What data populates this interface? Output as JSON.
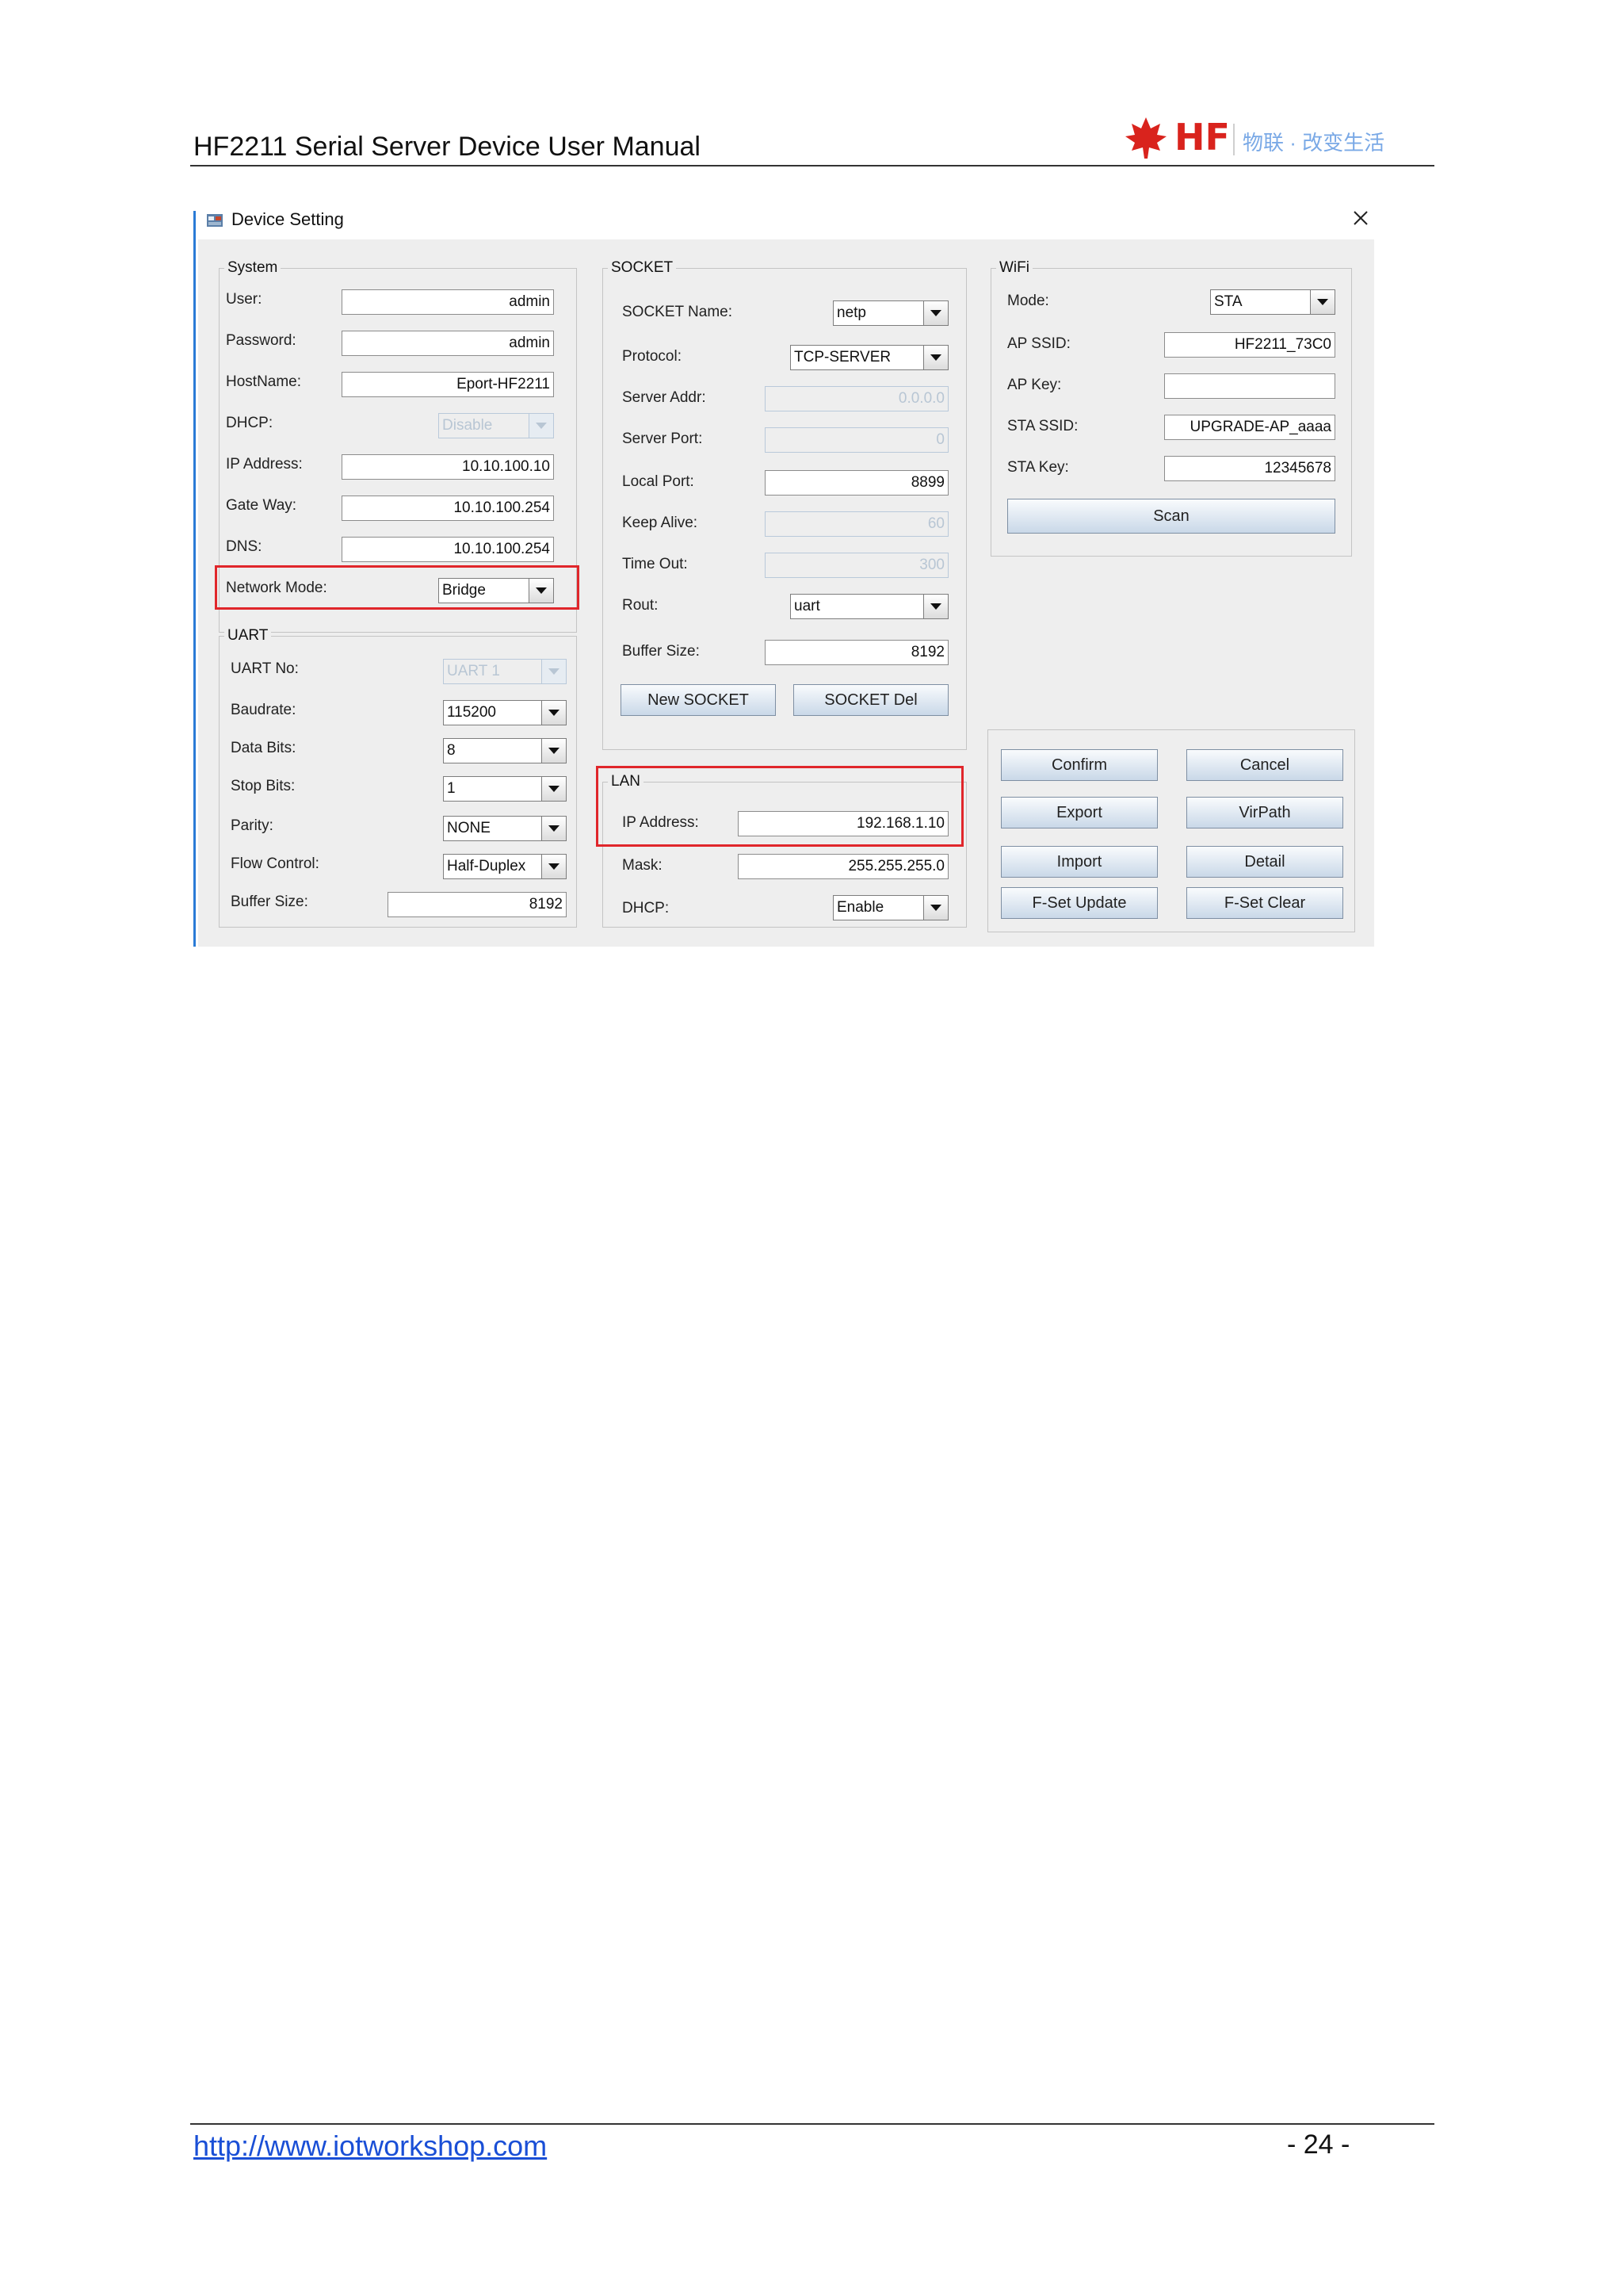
{
  "header": {
    "doc_title": "HF2211 Serial Server Device User Manual",
    "logo_text": "HF",
    "logo_slogan": "物联 · 改变生活"
  },
  "footer": {
    "link": "http://www.iotworkshop.com",
    "page_number": "- 24 -"
  },
  "dialog": {
    "title": "Device Setting",
    "system": {
      "label": "System",
      "user_label": "User:",
      "user": "admin",
      "password_label": "Password:",
      "password": "admin",
      "hostname_label": "HostName:",
      "hostname": "Eport-HF2211",
      "dhcp_label": "DHCP:",
      "dhcp": "Disable",
      "ip_label": "IP Address:",
      "ip": "10.10.100.10",
      "gateway_label": "Gate Way:",
      "gateway": "10.10.100.254",
      "dns_label": "DNS:",
      "dns": "10.10.100.254",
      "network_mode_label": "Network Mode:",
      "network_mode": "Bridge"
    },
    "uart": {
      "label": "UART",
      "uart_no_label": "UART No:",
      "uart_no": "UART 1",
      "baudrate_label": "Baudrate:",
      "baudrate": "115200",
      "data_bits_label": "Data Bits:",
      "data_bits": "8",
      "stop_bits_label": "Stop Bits:",
      "stop_bits": "1",
      "parity_label": "Parity:",
      "parity": "NONE",
      "flow_control_label": "Flow Control:",
      "flow_control": "Half-Duplex",
      "buffer_size_label": "Buffer Size:",
      "buffer_size": "8192"
    },
    "socket": {
      "label": "SOCKET",
      "name_label": "SOCKET Name:",
      "name": "netp",
      "protocol_label": "Protocol:",
      "protocol": "TCP-SERVER",
      "server_addr_label": "Server Addr:",
      "server_addr": "0.0.0.0",
      "server_port_label": "Server Port:",
      "server_port": "0",
      "local_port_label": "Local Port:",
      "local_port": "8899",
      "keep_alive_label": "Keep Alive:",
      "keep_alive": "60",
      "time_out_label": "Time Out:",
      "time_out": "300",
      "rout_label": "Rout:",
      "rout": "uart",
      "buffer_size_label": "Buffer Size:",
      "buffer_size": "8192",
      "new_socket": "New SOCKET",
      "socket_del": "SOCKET Del"
    },
    "lan": {
      "label": "LAN",
      "ip_label": "IP Address:",
      "ip": "192.168.1.10",
      "mask_label": "Mask:",
      "mask": "255.255.255.0",
      "dhcp_label": "DHCP:",
      "dhcp": "Enable"
    },
    "wifi": {
      "label": "WiFi",
      "mode_label": "Mode:",
      "mode": "STA",
      "ap_ssid_label": "AP SSID:",
      "ap_ssid": "HF2211_73C0",
      "ap_key_label": "AP Key:",
      "ap_key": "",
      "sta_ssid_label": "STA SSID:",
      "sta_ssid": "UPGRADE-AP_aaaa",
      "sta_key_label": "STA Key:",
      "sta_key": "12345678",
      "scan": "Scan"
    },
    "actions": {
      "confirm": "Confirm",
      "cancel": "Cancel",
      "export": "Export",
      "virpath": "VirPath",
      "import": "Import",
      "detail": "Detail",
      "fset_update": "F-Set Update",
      "fset_clear": "F-Set Clear"
    },
    "colors": {
      "highlight": "#e0262b",
      "accent": "#2a7bd6",
      "brand": "#d9231d"
    }
  }
}
